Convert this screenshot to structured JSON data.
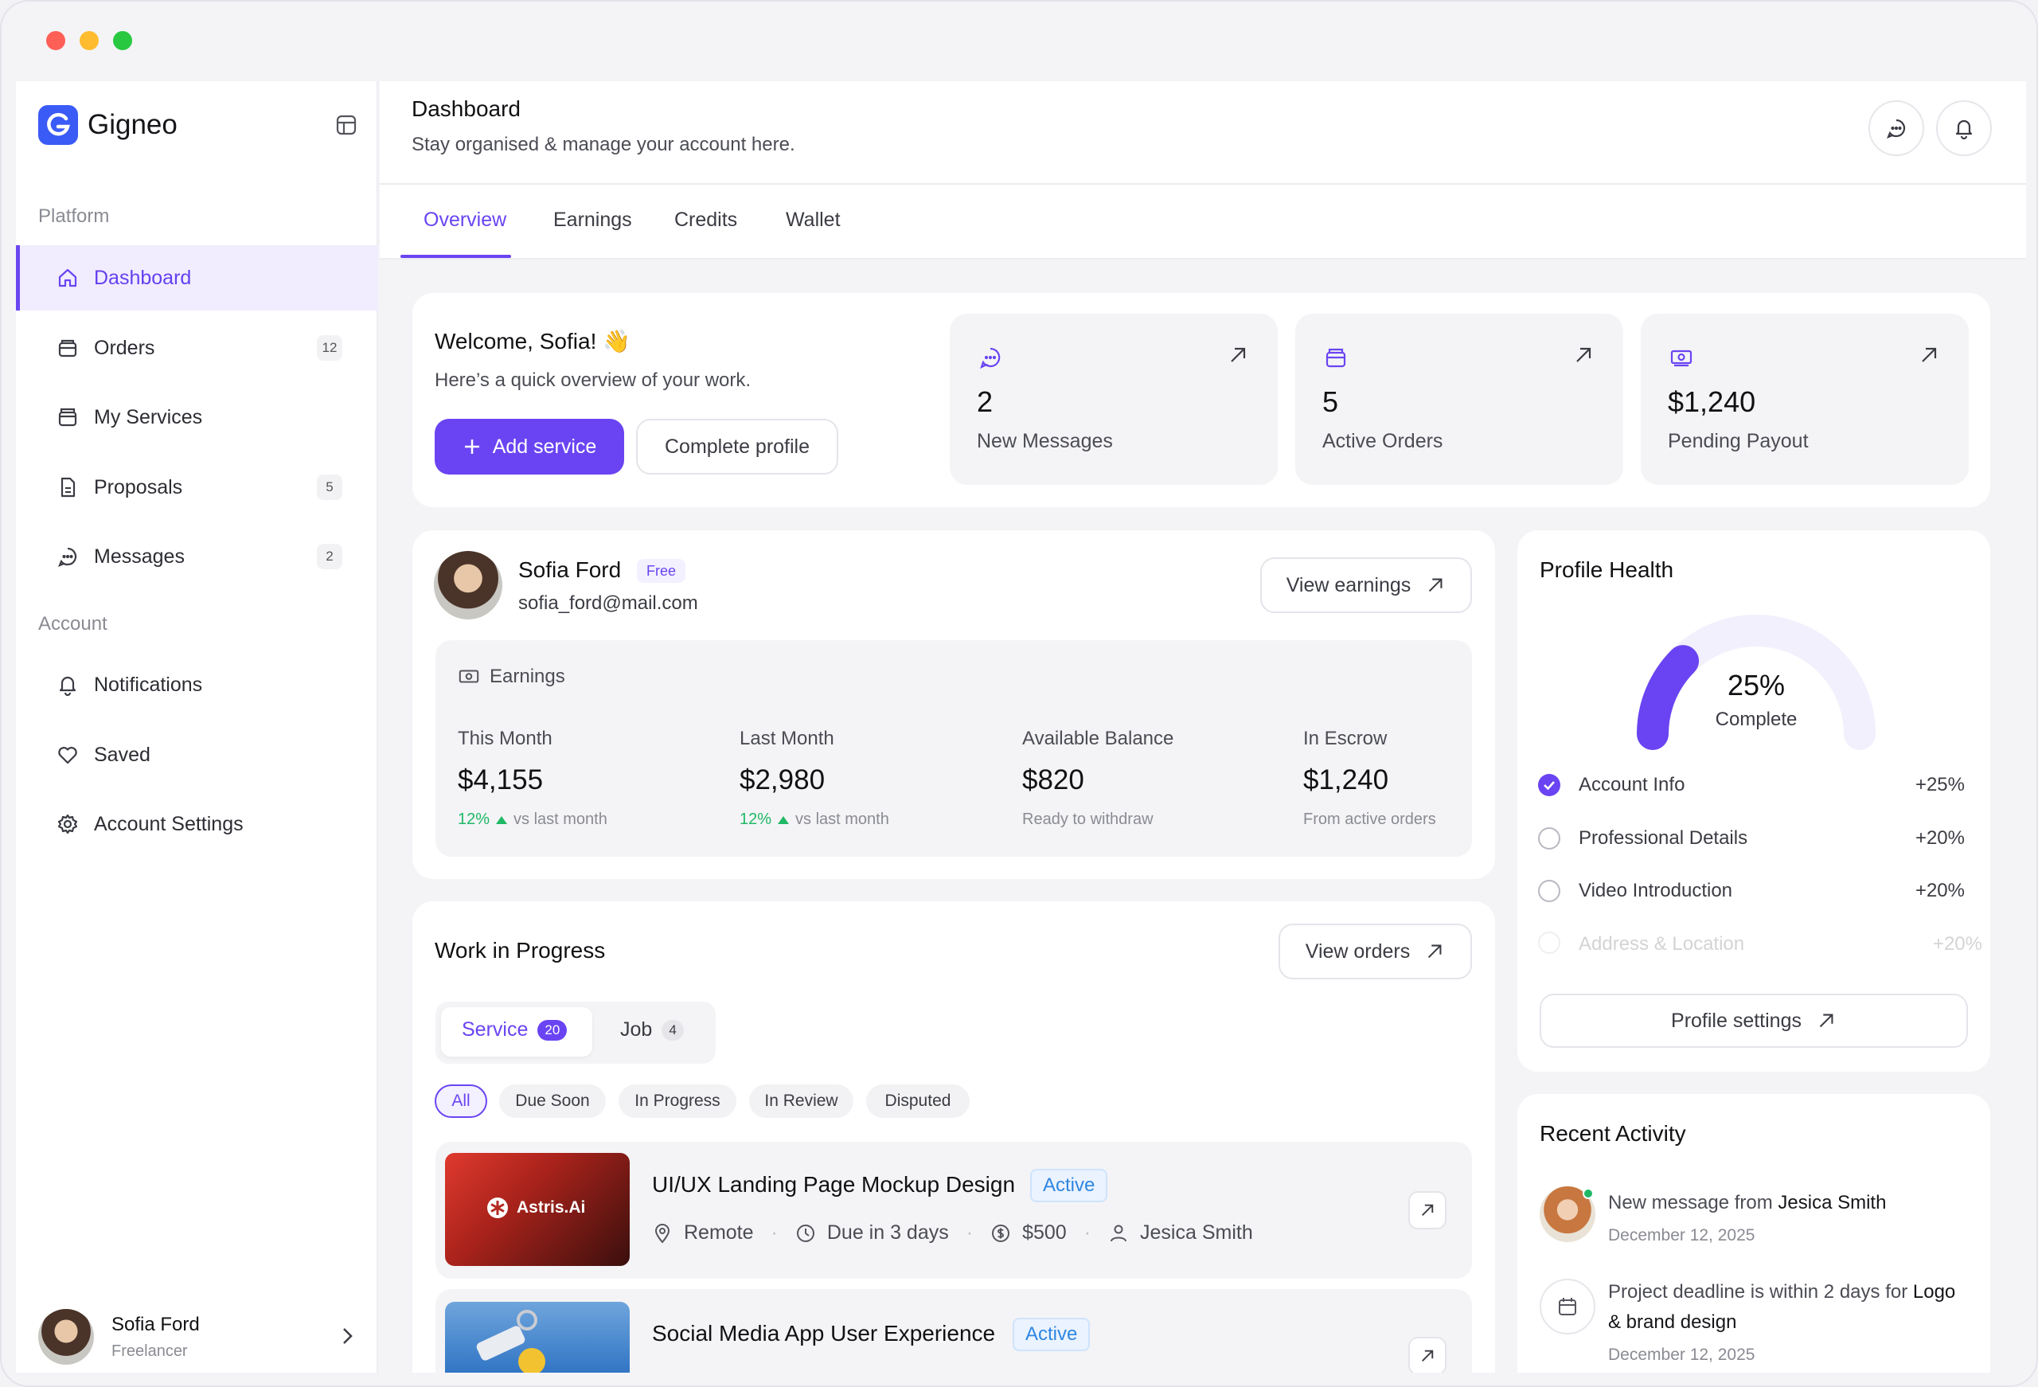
{
  "app": {
    "name": "Gigneo"
  },
  "sidebar": {
    "platform_label": "Platform",
    "account_label": "Account",
    "items": [
      {
        "label": "Dashboard",
        "badge": "",
        "icon": "home-icon"
      },
      {
        "label": "Orders",
        "badge": "12",
        "icon": "box-icon"
      },
      {
        "label": "My Services",
        "badge": "",
        "icon": "briefcase-icon"
      },
      {
        "label": "Proposals",
        "badge": "5",
        "icon": "document-icon"
      },
      {
        "label": "Messages",
        "badge": "2",
        "icon": "chat-icon"
      }
    ],
    "account_items": [
      {
        "label": "Notifications",
        "icon": "bell-icon"
      },
      {
        "label": "Saved",
        "icon": "heart-icon"
      },
      {
        "label": "Account Settings",
        "icon": "gear-icon"
      }
    ],
    "user": {
      "name": "Sofia Ford",
      "role": "Freelancer"
    }
  },
  "header": {
    "title": "Dashboard",
    "subtitle": "Stay organised & manage your account here."
  },
  "tabs": [
    "Overview",
    "Earnings",
    "Credits",
    "Wallet"
  ],
  "welcome": {
    "title": "Welcome, Sofia! 👋",
    "subtitle": "Here’s a quick overview of your work.",
    "add_service": "Add service",
    "complete_profile": "Complete profile"
  },
  "stats": [
    {
      "value": "2",
      "label": "New Messages",
      "icon": "chat-icon"
    },
    {
      "value": "5",
      "label": "Active Orders",
      "icon": "bag-icon"
    },
    {
      "value": "$1,240",
      "label": "Pending Payout",
      "icon": "cash-icon"
    }
  ],
  "profile": {
    "name": "Sofia Ford",
    "plan": "Free",
    "email": "sofia_ford@mail.com",
    "view_earnings": "View earnings"
  },
  "earnings": {
    "title": "Earnings",
    "cols": [
      {
        "label": "This Month",
        "value": "$4,155",
        "change": "12%",
        "note": "vs last month"
      },
      {
        "label": "Last Month",
        "value": "$2,980",
        "change": "12%",
        "note": "vs last month"
      },
      {
        "label": "Available Balance",
        "value": "$820",
        "note": "Ready to withdraw"
      },
      {
        "label": "In Escrow",
        "value": "$1,240",
        "note": "From active orders"
      }
    ]
  },
  "wip": {
    "title": "Work in Progress",
    "view_orders": "View orders",
    "seg": [
      {
        "label": "Service",
        "count": "20"
      },
      {
        "label": "Job",
        "count": "4"
      }
    ],
    "chips": [
      "All",
      "Due Soon",
      "In Progress",
      "In Review",
      "Disputed"
    ],
    "jobs": [
      {
        "title": "UI/UX Landing Page Mockup Design",
        "status": "Active",
        "location": "Remote",
        "due": "Due in 3 days",
        "price": "$500",
        "client": "Jesica Smith",
        "thumb_text": "Astris.Ai"
      },
      {
        "title": "Social Media App User Experience",
        "status": "Active"
      }
    ]
  },
  "health": {
    "title": "Profile Health",
    "percent": "25%",
    "percent_value": 25,
    "complete_label": "Complete",
    "items": [
      {
        "label": "Account Info",
        "value": "+25%",
        "done": true
      },
      {
        "label": "Professional Details",
        "value": "+20%",
        "done": false
      },
      {
        "label": "Video Introduction",
        "value": "+20%",
        "done": false
      },
      {
        "label": "Address & Location",
        "value": "+20%",
        "done": false
      }
    ],
    "settings": "Profile settings"
  },
  "activity": {
    "title": "Recent Activity",
    "items": [
      {
        "text": "New message from",
        "bold": "Jesica Smith",
        "date": "December 12, 2025"
      },
      {
        "text": "Project deadline is within 2 days for",
        "bold": "Logo & brand design",
        "date": "December 12, 2025"
      }
    ]
  },
  "colors": {
    "accent": "#6A44F2",
    "positive": "#1FB866",
    "status_active": "#2F86E0"
  }
}
